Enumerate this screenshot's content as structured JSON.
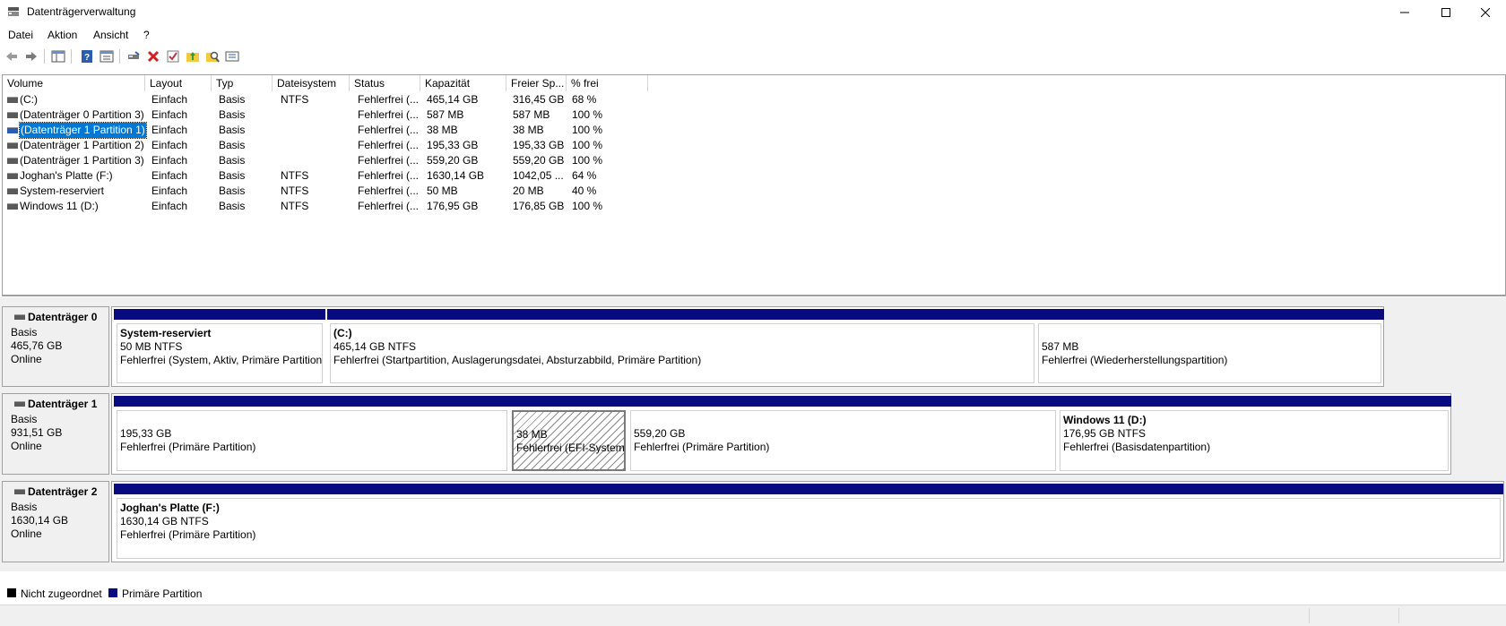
{
  "window": {
    "title": "Datenträgerverwaltung"
  },
  "menu": [
    "Datei",
    "Aktion",
    "Ansicht",
    "?"
  ],
  "toolbar": {
    "icons": [
      "back-icon",
      "forward-icon",
      "show-hide-tree-icon",
      "help-icon",
      "properties-view-icon",
      "connect-icon",
      "delete-icon",
      "check-icon",
      "folder-up-icon",
      "search-folder-icon",
      "settings-icon"
    ]
  },
  "volumes": {
    "columns": [
      "Volume",
      "Layout",
      "Typ",
      "Dateisystem",
      "Status",
      "Kapazität",
      "Freier Sp...",
      "% frei"
    ],
    "rows": [
      {
        "name": " (C:)",
        "layout": "Einfach",
        "typ": "Basis",
        "fs": "NTFS",
        "status": "Fehlerfrei (...",
        "cap": "465,14 GB",
        "free": "316,45 GB",
        "pct": "68 %"
      },
      {
        "name": "(Datenträger 0 Partition 3)",
        "layout": "Einfach",
        "typ": "Basis",
        "fs": "",
        "status": "Fehlerfrei (...",
        "cap": "587 MB",
        "free": "587 MB",
        "pct": "100 %"
      },
      {
        "name": "(Datenträger 1 Partition 1)",
        "layout": "Einfach",
        "typ": "Basis",
        "fs": "",
        "status": "Fehlerfrei (...",
        "cap": "38 MB",
        "free": "38 MB",
        "pct": "100 %",
        "selected": true
      },
      {
        "name": "(Datenträger 1 Partition 2)",
        "layout": "Einfach",
        "typ": "Basis",
        "fs": "",
        "status": "Fehlerfrei (...",
        "cap": "195,33 GB",
        "free": "195,33 GB",
        "pct": "100 %"
      },
      {
        "name": "(Datenträger 1 Partition 3)",
        "layout": "Einfach",
        "typ": "Basis",
        "fs": "",
        "status": "Fehlerfrei (...",
        "cap": "559,20 GB",
        "free": "559,20 GB",
        "pct": "100 %"
      },
      {
        "name": "Joghan's Platte (F:)",
        "layout": "Einfach",
        "typ": "Basis",
        "fs": "NTFS",
        "status": "Fehlerfrei (...",
        "cap": "1630,14 GB",
        "free": "1042,05 ...",
        "pct": "64 %"
      },
      {
        "name": "System-reserviert",
        "layout": "Einfach",
        "typ": "Basis",
        "fs": "NTFS",
        "status": "Fehlerfrei (...",
        "cap": "50 MB",
        "free": "20 MB",
        "pct": "40 %"
      },
      {
        "name": "Windows 11 (D:)",
        "layout": "Einfach",
        "typ": "Basis",
        "fs": "NTFS",
        "status": "Fehlerfrei (...",
        "cap": "176,95 GB",
        "free": "176,85 GB",
        "pct": "100 %"
      }
    ]
  },
  "disks": [
    {
      "name": "Datenträger 0",
      "type": "Basis",
      "size": "465,76 GB",
      "state": "Online",
      "partitions": [
        {
          "title": "System-reserviert",
          "line1": "50 MB NTFS",
          "line2": "Fehlerfrei (System, Aktiv, Primäre Partition"
        },
        {
          "title": " (C:)",
          "line1": "465,14 GB NTFS",
          "line2": "Fehlerfrei (Startpartition, Auslagerungsdatei, Absturzabbild, Primäre Partition)"
        },
        {
          "title": "",
          "line1": "587 MB",
          "line2": "Fehlerfrei (Wiederherstellungspartition)"
        }
      ]
    },
    {
      "name": "Datenträger 1",
      "type": "Basis",
      "size": "931,51 GB",
      "state": "Online",
      "partitions": [
        {
          "title": "",
          "line1": "195,33 GB",
          "line2": "Fehlerfrei (Primäre Partition)"
        },
        {
          "title": "",
          "line1": "38 MB",
          "line2": "Fehlerfrei (EFI-Systempartition)"
        },
        {
          "title": "",
          "line1": "559,20 GB",
          "line2": "Fehlerfrei (Primäre Partition)"
        },
        {
          "title": "Windows 11  (D:)",
          "line1": "176,95 GB NTFS",
          "line2": "Fehlerfrei (Basisdatenpartition)"
        }
      ]
    },
    {
      "name": "Datenträger 2",
      "type": "Basis",
      "size": "1630,14 GB",
      "state": "Online",
      "partitions": [
        {
          "title": "Joghan's Platte  (F:)",
          "line1": "1630,14 GB NTFS",
          "line2": "Fehlerfrei (Primäre Partition)"
        }
      ]
    }
  ],
  "legend": {
    "unallocated": "Nicht zugeordnet",
    "primary": "Primäre Partition",
    "colors": {
      "unallocated": "#000000",
      "primary": "#0a0a80"
    }
  },
  "colors": {
    "selection": "#0078d7",
    "partition_bar": "#0a0a80"
  }
}
